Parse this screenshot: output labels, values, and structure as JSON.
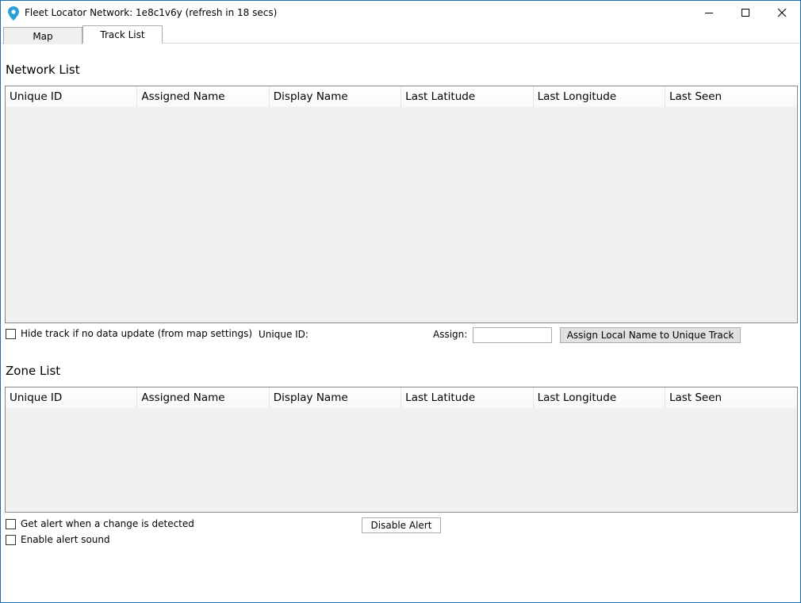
{
  "window": {
    "title": "Fleet Locator Network: 1e8c1v6y (refresh in 18 secs)"
  },
  "tabs": [
    {
      "label": "Map"
    },
    {
      "label": "Track List"
    }
  ],
  "network_list": {
    "title": "Network List",
    "columns": [
      "Unique ID",
      "Assigned Name",
      "Display Name",
      "Last Latitude",
      "Last Longitude",
      "Last Seen"
    ],
    "rows": []
  },
  "network_controls": {
    "hide_track_label": "Hide track if no data update (from map settings)",
    "hide_track_checked": false,
    "unique_id_label": "Unique ID:",
    "unique_id_value": "",
    "assign_label": "Assign:",
    "assign_value": "",
    "assign_button_label": "Assign Local Name to Unique Track"
  },
  "zone_list": {
    "title": "Zone List",
    "columns": [
      "Unique ID",
      "Assigned Name",
      "Display Name",
      "Last Latitude",
      "Last Longitude",
      "Last Seen"
    ],
    "rows": []
  },
  "zone_controls": {
    "alert_on_change_label": "Get alert when a change is detected",
    "alert_on_change_checked": false,
    "alert_sound_label": "Enable alert sound",
    "alert_sound_checked": false,
    "disable_alert_label": "Disable Alert"
  },
  "colors": {
    "grid_background": "#f0f0f0",
    "window_border": "#1f6fb4",
    "app_icon": "#2a9fd8"
  }
}
